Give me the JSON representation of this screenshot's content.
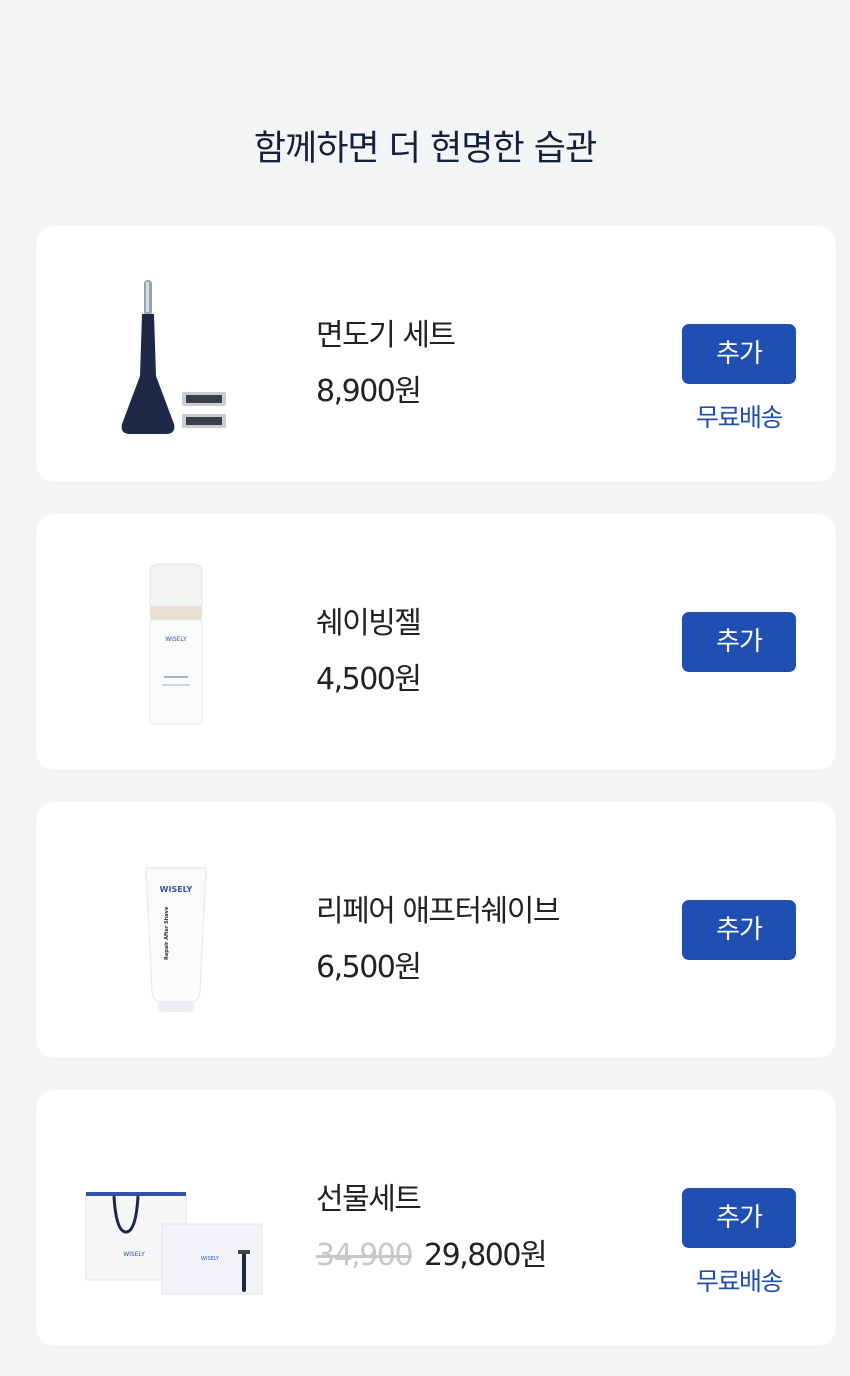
{
  "header": {
    "title": "함께하면 더 현명한 습관"
  },
  "products": [
    {
      "name": "면도기 세트",
      "price": "8,900원",
      "add_label": "추가",
      "shipping": "무료배송"
    },
    {
      "name": "쉐이빙젤",
      "price": "4,500원",
      "add_label": "추가"
    },
    {
      "name": "리페어 애프터쉐이브",
      "price": "6,500원",
      "add_label": "추가"
    },
    {
      "name": "선물세트",
      "original_price": "34,900",
      "price": "29,800원",
      "add_label": "추가",
      "shipping": "무료배송"
    }
  ],
  "product_images": {
    "gel_brand": "WISELY",
    "aftershave_brand": "WISELY",
    "aftershave_tube_text": "Repair After Shave",
    "gift_bag_brand": "WISELY",
    "gift_box_brand": "WISELY"
  },
  "colors": {
    "accent": "#1f4fb0",
    "background": "#f4f5f7",
    "razor": "#1c2846"
  }
}
